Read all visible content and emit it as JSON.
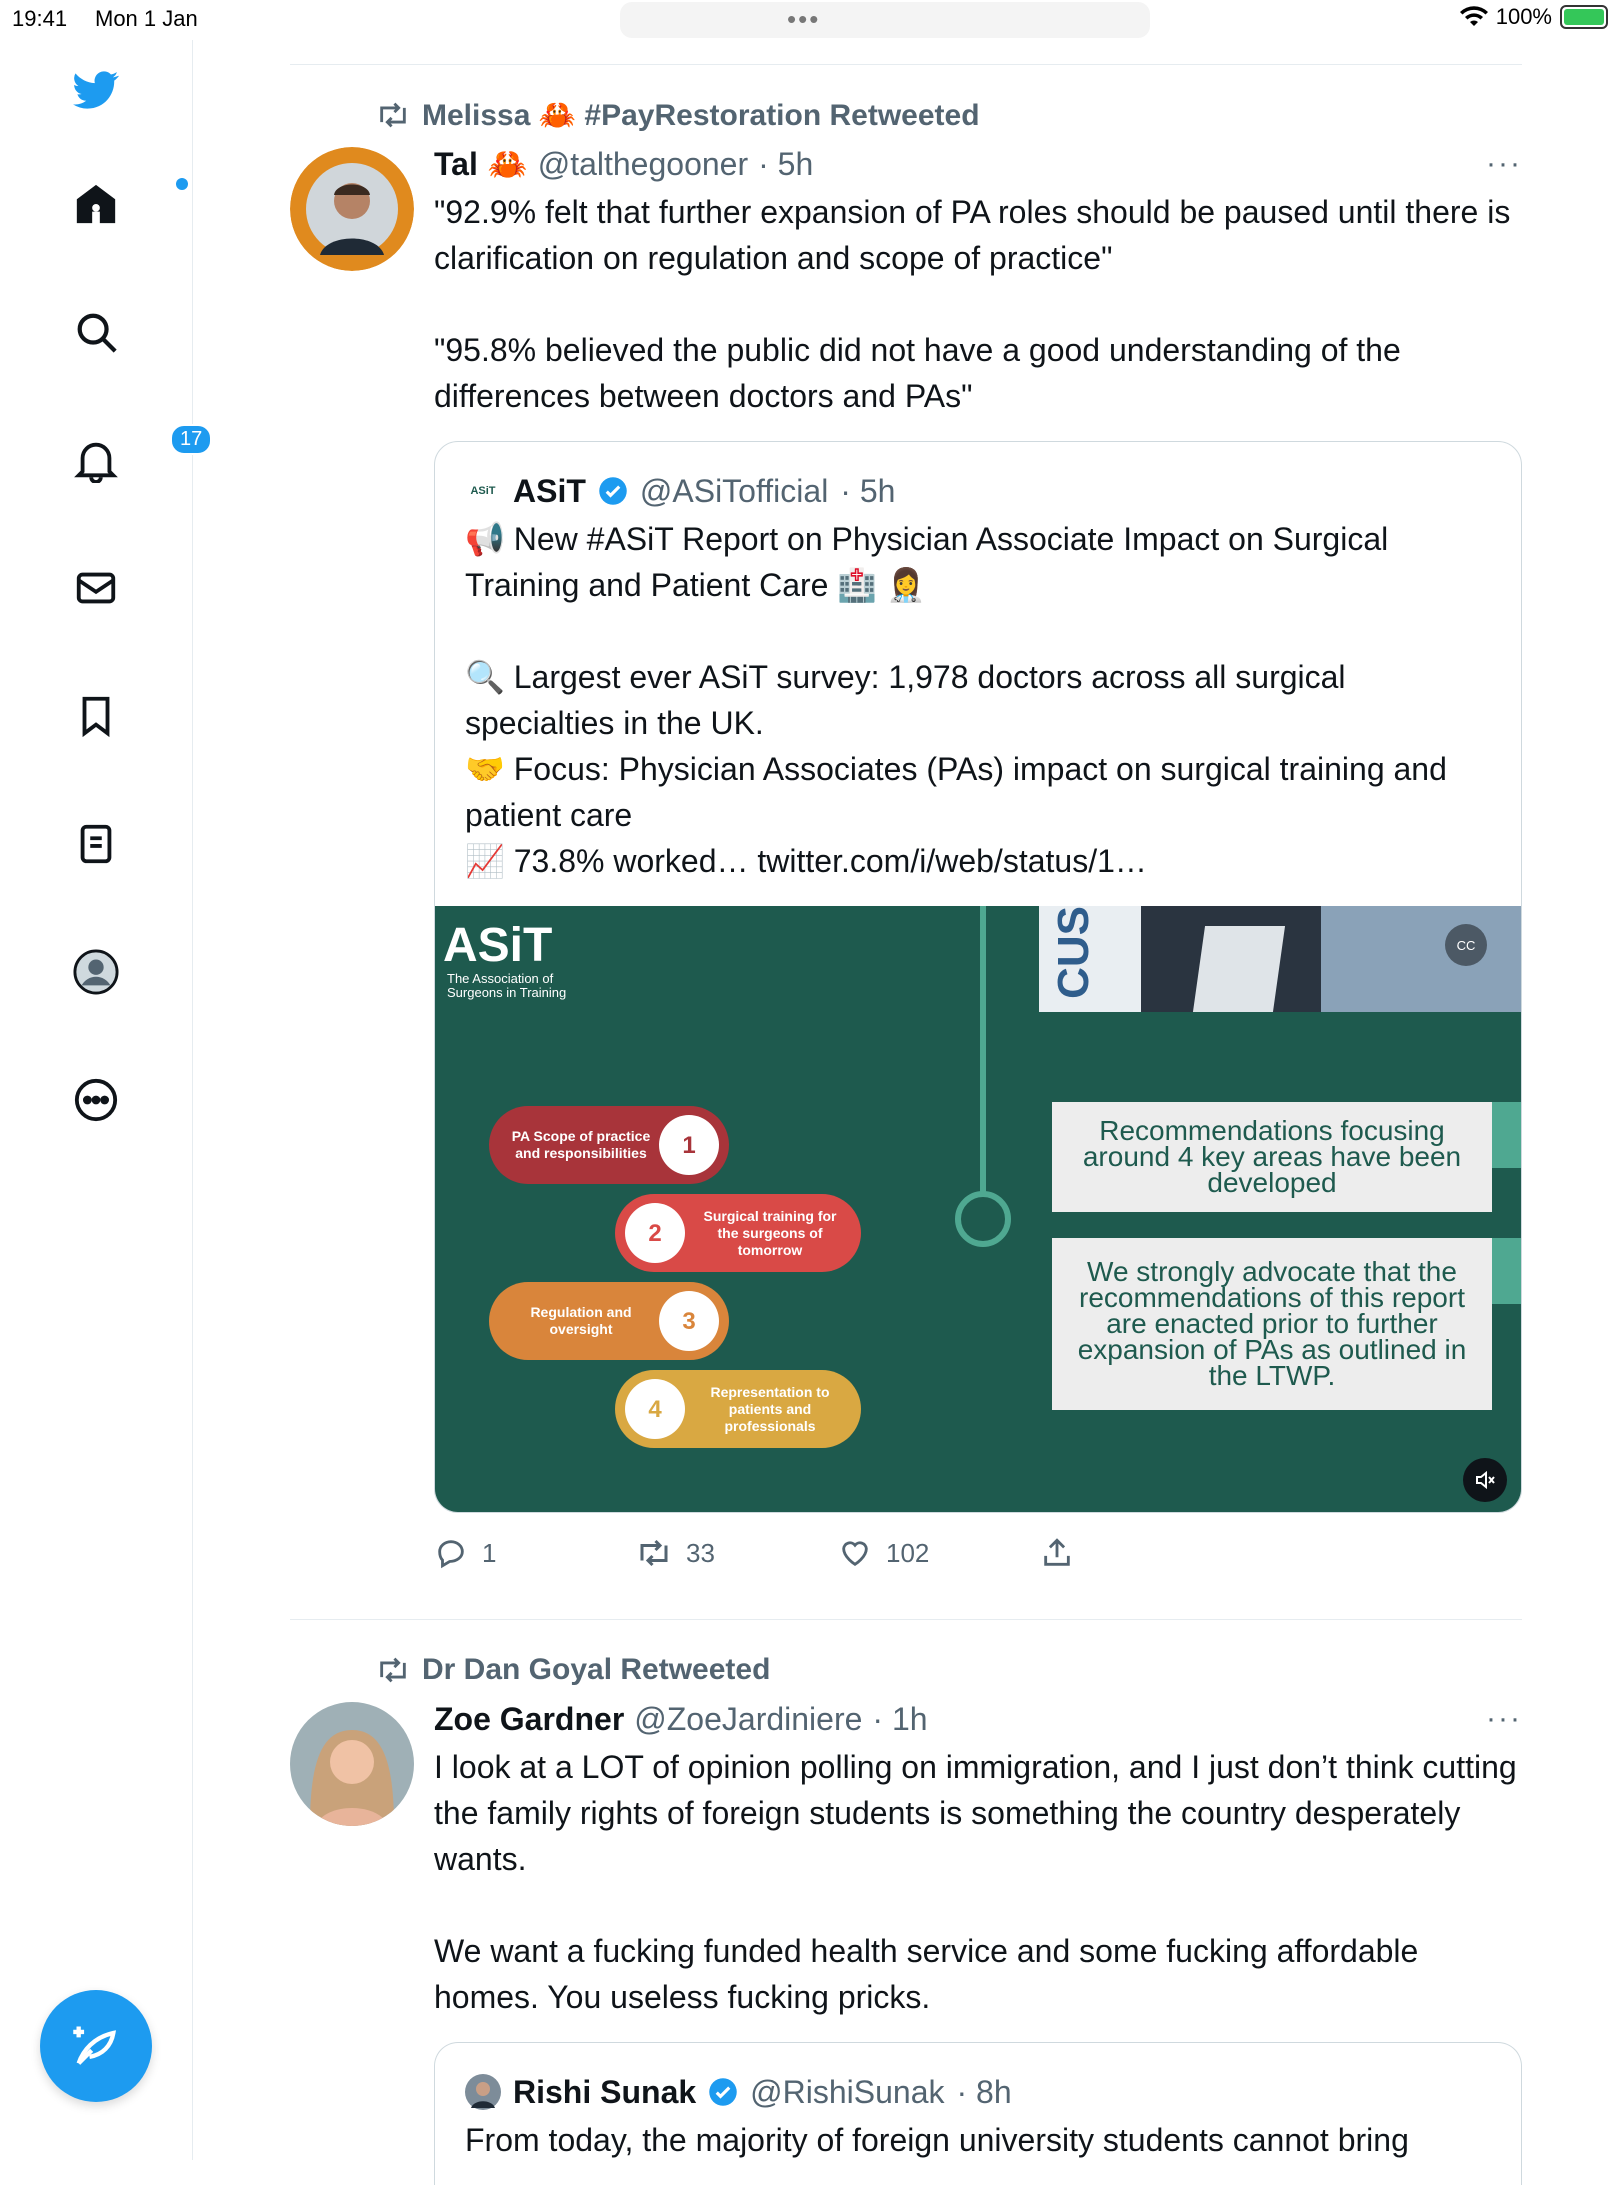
{
  "status_bar": {
    "time": "19:41",
    "date": "Mon 1 Jan",
    "dots": "•••",
    "battery": "100%"
  },
  "sidebar": {
    "items": [
      {
        "name": "twitter-logo"
      },
      {
        "name": "home"
      },
      {
        "name": "search"
      },
      {
        "name": "notifications",
        "badge": "17"
      },
      {
        "name": "messages"
      },
      {
        "name": "bookmarks"
      },
      {
        "name": "lists"
      },
      {
        "name": "profile"
      },
      {
        "name": "more"
      }
    ]
  },
  "tweets": [
    {
      "retweeted_by": "Melissa 🦀 #PayRestoration Retweeted",
      "name": "Tal",
      "emoji": "🦀",
      "handle": "@talthegooner",
      "time": "· 5h",
      "text": "\"92.9% felt that further expansion of PA roles should be paused until there is clarification on regulation and scope of practice\"\n\n\"95.8% believed the public did not have a good understanding of the differences between doctors and PAs\"",
      "quote": {
        "logo": "ASiT",
        "name": "ASiT",
        "handle": "@ASiTofficial",
        "time": "· 5h",
        "text": "📢 New #ASiT Report on Physician Associate Impact on Surgical Training and Patient Care 🏥 👩‍⚕️\n\n🔍 Largest ever ASiT survey: 1,978 doctors across all surgical specialties in the UK.\n🤝 Focus: Physician Associates (PAs) impact on surgical training and patient care\n📈 73.8% worked… twitter.com/i/web/status/1…",
        "media": {
          "brand": "ASiT",
          "brand_sub": "The Association of Surgeons in Training",
          "banner_text": "CUS",
          "steps": [
            {
              "num": "1",
              "label": "PA Scope of practice and responsibilities",
              "color": "#a8343a"
            },
            {
              "num": "2",
              "label": "Surgical training for the surgeons of tomorrow",
              "color": "#d94a47"
            },
            {
              "num": "3",
              "label": "Regulation and oversight",
              "color": "#d9853b"
            },
            {
              "num": "4",
              "label": "Representation to patients and professionals",
              "color": "#d9a842"
            }
          ],
          "rec1": "Recommendations focusing around 4 key areas have been developed",
          "rec2": "We strongly advocate that the recommendations of this report are enacted prior to further expansion of PAs as outlined in the LTWP."
        }
      },
      "stats": {
        "replies": "1",
        "retweets": "33",
        "likes": "102"
      }
    },
    {
      "retweeted_by": "Dr Dan Goyal Retweeted",
      "name": "Zoe Gardner",
      "handle": "@ZoeJardiniere",
      "time": "· 1h",
      "text": "I look at a LOT of opinion polling on immigration, and I just don’t think cutting the family rights of foreign students is something the country desperately wants.\n\nWe want a fucking funded health service and some fucking affordable homes. You useless fucking pricks.",
      "quote": {
        "name": "Rishi Sunak",
        "handle": "@RishiSunak",
        "time": "· 8h",
        "text": "From today, the majority of foreign university students cannot bring"
      }
    }
  ],
  "colors": {
    "accent": "#1d9bf0",
    "text": "#0f1419",
    "muted": "#536471",
    "media_bg": "#1e5a4e"
  }
}
